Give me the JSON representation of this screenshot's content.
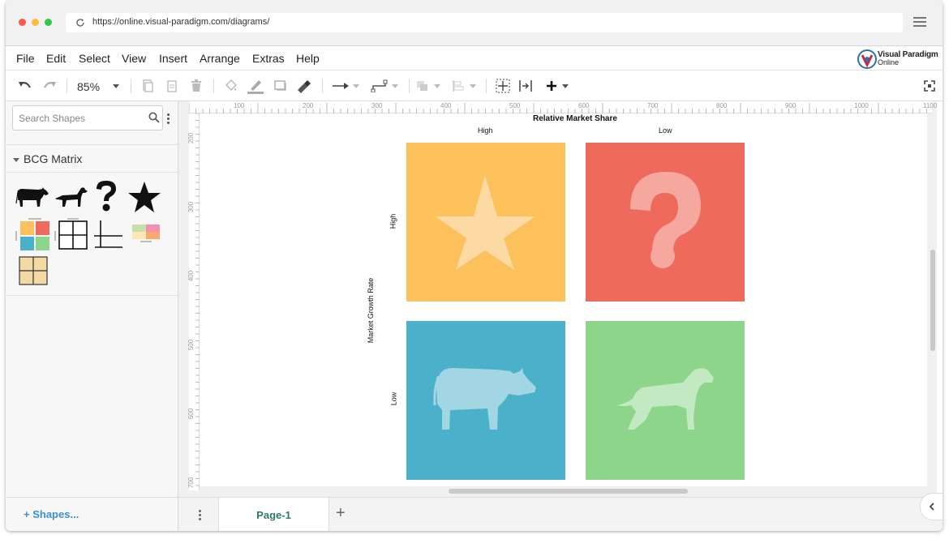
{
  "browser": {
    "url": "https://online.visual-paradigm.com/diagrams/",
    "traffic_lights": [
      "#fc5753",
      "#fdbc40",
      "#33c748"
    ]
  },
  "menu": {
    "items": [
      "File",
      "Edit",
      "Select",
      "View",
      "Insert",
      "Arrange",
      "Extras",
      "Help"
    ]
  },
  "brand": {
    "name": "Visual Paradigm",
    "sub": "Online",
    "icon": "vp-logo-icon"
  },
  "toolbar": {
    "zoom": "85%",
    "icons": [
      "undo-icon",
      "redo-icon",
      "copy-icon",
      "paste-icon",
      "delete-icon",
      "fill-color-icon",
      "line-color-icon",
      "shadow-icon",
      "format-painter-icon",
      "connector-icon",
      "waypoint-icon",
      "to-front-icon",
      "align-icon",
      "select-all-icon",
      "fit-icon",
      "insert-plus-icon",
      "fullscreen-icon"
    ]
  },
  "sidebar": {
    "search_placeholder": "Search Shapes",
    "section_title": "BCG Matrix",
    "shapes": [
      "cow-shape",
      "dog-shape",
      "question-mark-shape",
      "star-shape",
      "bcg-color-matrix-shape",
      "grid-matrix-shape",
      "cross-axis-shape",
      "pastel-matrix-shape",
      "tan-matrix-shape"
    ],
    "more_shapes_label": "Shapes..."
  },
  "ruler": {
    "top_labels": [
      "100",
      "200",
      "300",
      "400",
      "500",
      "600",
      "700",
      "800",
      "900",
      "1000",
      "1100"
    ],
    "left_labels": [
      "200",
      "300",
      "400",
      "500",
      "600",
      "700"
    ]
  },
  "diagram": {
    "top_axis_title": "Relative Market Share",
    "top_high": "High",
    "top_low": "Low",
    "left_axis_title": "Market Growth Rate",
    "left_high": "High",
    "left_low": "Low",
    "quadrants": [
      {
        "name": "star",
        "color": "#fdc15b",
        "icon": "star-icon"
      },
      {
        "name": "question-mark",
        "color": "#ee6a5c",
        "icon": "question-mark-icon"
      },
      {
        "name": "cash-cow",
        "color": "#4bb1ca",
        "icon": "cow-icon"
      },
      {
        "name": "dog",
        "color": "#8ed58c",
        "icon": "dog-icon"
      }
    ]
  },
  "pages": {
    "current": "Page-1"
  }
}
